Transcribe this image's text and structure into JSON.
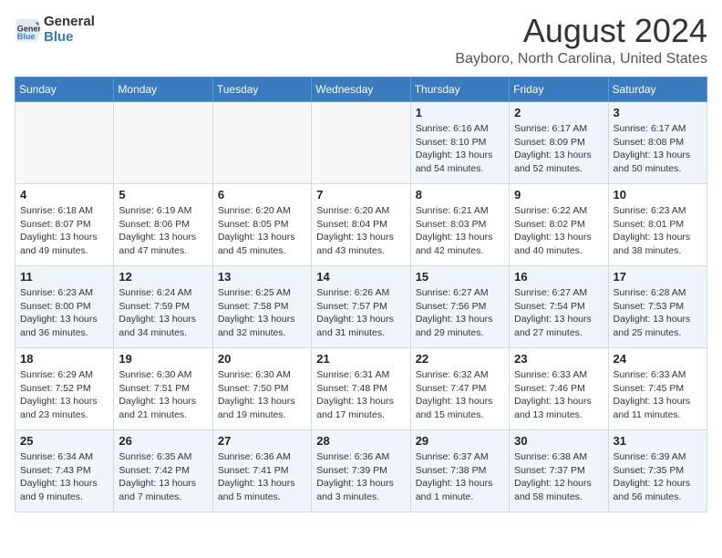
{
  "logo": {
    "text1": "General",
    "text2": "Blue"
  },
  "header": {
    "month": "August 2024",
    "location": "Bayboro, North Carolina, United States"
  },
  "weekdays": [
    "Sunday",
    "Monday",
    "Tuesday",
    "Wednesday",
    "Thursday",
    "Friday",
    "Saturday"
  ],
  "weeks": [
    [
      {
        "num": "",
        "info": ""
      },
      {
        "num": "",
        "info": ""
      },
      {
        "num": "",
        "info": ""
      },
      {
        "num": "",
        "info": ""
      },
      {
        "num": "1",
        "info": "Sunrise: 6:16 AM\nSunset: 8:10 PM\nDaylight: 13 hours\nand 54 minutes."
      },
      {
        "num": "2",
        "info": "Sunrise: 6:17 AM\nSunset: 8:09 PM\nDaylight: 13 hours\nand 52 minutes."
      },
      {
        "num": "3",
        "info": "Sunrise: 6:17 AM\nSunset: 8:08 PM\nDaylight: 13 hours\nand 50 minutes."
      }
    ],
    [
      {
        "num": "4",
        "info": "Sunrise: 6:18 AM\nSunset: 8:07 PM\nDaylight: 13 hours\nand 49 minutes."
      },
      {
        "num": "5",
        "info": "Sunrise: 6:19 AM\nSunset: 8:06 PM\nDaylight: 13 hours\nand 47 minutes."
      },
      {
        "num": "6",
        "info": "Sunrise: 6:20 AM\nSunset: 8:05 PM\nDaylight: 13 hours\nand 45 minutes."
      },
      {
        "num": "7",
        "info": "Sunrise: 6:20 AM\nSunset: 8:04 PM\nDaylight: 13 hours\nand 43 minutes."
      },
      {
        "num": "8",
        "info": "Sunrise: 6:21 AM\nSunset: 8:03 PM\nDaylight: 13 hours\nand 42 minutes."
      },
      {
        "num": "9",
        "info": "Sunrise: 6:22 AM\nSunset: 8:02 PM\nDaylight: 13 hours\nand 40 minutes."
      },
      {
        "num": "10",
        "info": "Sunrise: 6:23 AM\nSunset: 8:01 PM\nDaylight: 13 hours\nand 38 minutes."
      }
    ],
    [
      {
        "num": "11",
        "info": "Sunrise: 6:23 AM\nSunset: 8:00 PM\nDaylight: 13 hours\nand 36 minutes."
      },
      {
        "num": "12",
        "info": "Sunrise: 6:24 AM\nSunset: 7:59 PM\nDaylight: 13 hours\nand 34 minutes."
      },
      {
        "num": "13",
        "info": "Sunrise: 6:25 AM\nSunset: 7:58 PM\nDaylight: 13 hours\nand 32 minutes."
      },
      {
        "num": "14",
        "info": "Sunrise: 6:26 AM\nSunset: 7:57 PM\nDaylight: 13 hours\nand 31 minutes."
      },
      {
        "num": "15",
        "info": "Sunrise: 6:27 AM\nSunset: 7:56 PM\nDaylight: 13 hours\nand 29 minutes."
      },
      {
        "num": "16",
        "info": "Sunrise: 6:27 AM\nSunset: 7:54 PM\nDaylight: 13 hours\nand 27 minutes."
      },
      {
        "num": "17",
        "info": "Sunrise: 6:28 AM\nSunset: 7:53 PM\nDaylight: 13 hours\nand 25 minutes."
      }
    ],
    [
      {
        "num": "18",
        "info": "Sunrise: 6:29 AM\nSunset: 7:52 PM\nDaylight: 13 hours\nand 23 minutes."
      },
      {
        "num": "19",
        "info": "Sunrise: 6:30 AM\nSunset: 7:51 PM\nDaylight: 13 hours\nand 21 minutes."
      },
      {
        "num": "20",
        "info": "Sunrise: 6:30 AM\nSunset: 7:50 PM\nDaylight: 13 hours\nand 19 minutes."
      },
      {
        "num": "21",
        "info": "Sunrise: 6:31 AM\nSunset: 7:48 PM\nDaylight: 13 hours\nand 17 minutes."
      },
      {
        "num": "22",
        "info": "Sunrise: 6:32 AM\nSunset: 7:47 PM\nDaylight: 13 hours\nand 15 minutes."
      },
      {
        "num": "23",
        "info": "Sunrise: 6:33 AM\nSunset: 7:46 PM\nDaylight: 13 hours\nand 13 minutes."
      },
      {
        "num": "24",
        "info": "Sunrise: 6:33 AM\nSunset: 7:45 PM\nDaylight: 13 hours\nand 11 minutes."
      }
    ],
    [
      {
        "num": "25",
        "info": "Sunrise: 6:34 AM\nSunset: 7:43 PM\nDaylight: 13 hours\nand 9 minutes."
      },
      {
        "num": "26",
        "info": "Sunrise: 6:35 AM\nSunset: 7:42 PM\nDaylight: 13 hours\nand 7 minutes."
      },
      {
        "num": "27",
        "info": "Sunrise: 6:36 AM\nSunset: 7:41 PM\nDaylight: 13 hours\nand 5 minutes."
      },
      {
        "num": "28",
        "info": "Sunrise: 6:36 AM\nSunset: 7:39 PM\nDaylight: 13 hours\nand 3 minutes."
      },
      {
        "num": "29",
        "info": "Sunrise: 6:37 AM\nSunset: 7:38 PM\nDaylight: 13 hours\nand 1 minute."
      },
      {
        "num": "30",
        "info": "Sunrise: 6:38 AM\nSunset: 7:37 PM\nDaylight: 12 hours\nand 58 minutes."
      },
      {
        "num": "31",
        "info": "Sunrise: 6:39 AM\nSunset: 7:35 PM\nDaylight: 12 hours\nand 56 minutes."
      }
    ]
  ]
}
